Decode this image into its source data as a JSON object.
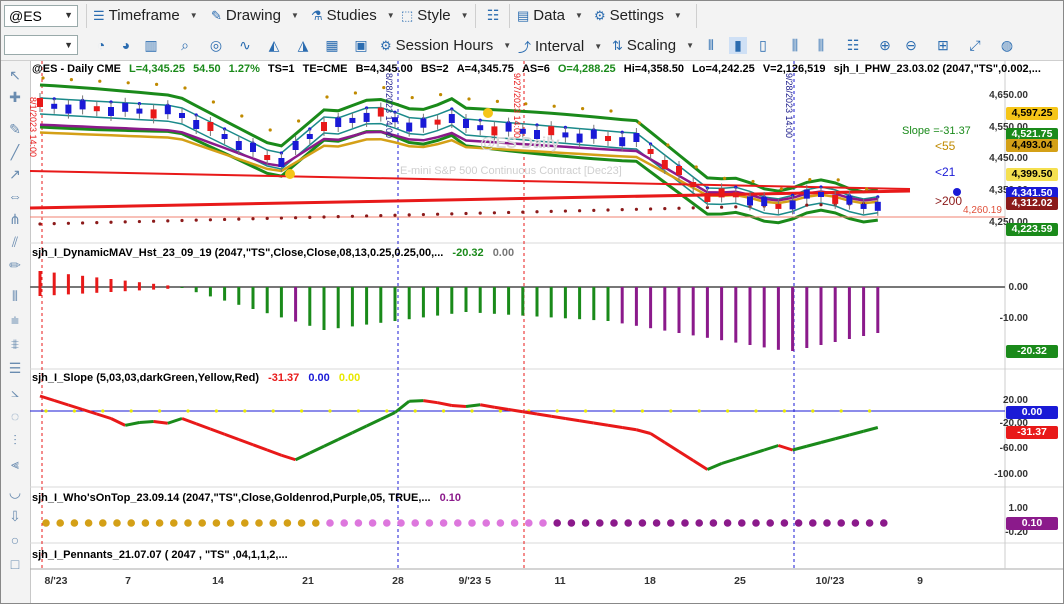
{
  "toolbar": {
    "symbol": "@ES",
    "menus": [
      "Timeframe",
      "Drawing",
      "Studies",
      "Style",
      "Data",
      "Settings"
    ],
    "row2": [
      "Session Hours",
      "Interval",
      "Scaling"
    ],
    "blank_combo": ""
  },
  "colors": {
    "accent": "#2b6cb0",
    "up": "#1a1ad6",
    "down": "#e81919",
    "green": "#1a8a1a",
    "purple": "#8b1a8b"
  },
  "header": {
    "symbol_title": "@ES - Daily  CME",
    "L": "L=4,345.25",
    "chg": "54.50",
    "chgpct": "1.27%",
    "ts": "TS=1",
    "te": "TE=CME",
    "bid": "B=4,345.00",
    "bs": "BS=2",
    "ask": "A=4,345.75",
    "as": "AS=6",
    "open": "O=4,288.25",
    "hi": "Hi=4,358.50",
    "lo": "Lo=4,242.25",
    "vol": "V=2,126,519",
    "study": "sjh_I_PHW_23.03.02 (2047,\"TS\",0.002,..."
  },
  "price_panel": {
    "watermark": "@ES Daily",
    "watermark2": "E-mini S&P 500 Continuous Contract [Dec23]",
    "slope_text": "Slope =-31.37",
    "lt55": "<55",
    "lt21": "<21",
    "gt200": ">200",
    "level_line": "4,260.19",
    "axis": [
      "4,650.00",
      "4,550.00",
      "4,450.00",
      "4,350.00",
      "4,250.00"
    ],
    "tags": [
      {
        "text": "4,597.25",
        "bg": "#f5c518",
        "fg": "#000"
      },
      {
        "text": "4,521.75",
        "bg": "#1a8a1a",
        "fg": "#fff"
      },
      {
        "text": "4,493.04",
        "bg": "#d4a017",
        "fg": "#000"
      },
      {
        "text": "4,399.50",
        "bg": "#f5e050",
        "fg": "#000"
      },
      {
        "text": "4,341.50",
        "bg": "#1a1ad6",
        "fg": "#fff"
      },
      {
        "text": "4,312.02",
        "bg": "#8b1a1a",
        "fg": "#fff"
      },
      {
        "text": "4,223.59",
        "bg": "#1a8a1a",
        "fg": "#fff"
      }
    ],
    "vlines": [
      "8/1/2023 14:00",
      "8/28/2023 14:00",
      "9/27/2023 14:00",
      "9/28/2023 14:00"
    ]
  },
  "hist_panel": {
    "title": "sjh_I_DynamicMAV_Hst_23_09_19 (2047,\"TS\",Close,Close,08,13,0.25,0.25,00,...",
    "v1": "-20.32",
    "v2": "0.00",
    "axis": [
      "0.00",
      "-10.00"
    ],
    "tag": "-20.32"
  },
  "slope_panel": {
    "title": "sjh_I_Slope (5,03,03,darkGreen,Yellow,Red)",
    "v1": "-31.37",
    "v2": "0.00",
    "v3": "0.00",
    "axis": [
      "20.00",
      "-20.00",
      "-60.00",
      "-100.00"
    ],
    "tag0": "0.00",
    "tag1": "-31.37"
  },
  "who_panel": {
    "title": "sjh_I_Who'sOnTop_23.09.14 (2047,\"TS\",Close,Goldenrod,Purple,05,  TRUE,...",
    "v1": "0.10",
    "axis": [
      "1.00",
      "-0.20"
    ],
    "tag": "0.10"
  },
  "pennant_panel": {
    "title": "sjh_I_Pennants_21.07.07 (  2047 ,  \"TS\" ,04,1,1,2,..."
  },
  "xaxis": [
    "8/'23",
    "7",
    "14",
    "21",
    "28",
    "9/'23",
    "5",
    "11",
    "18",
    "25",
    "10/'23",
    "9"
  ]
}
